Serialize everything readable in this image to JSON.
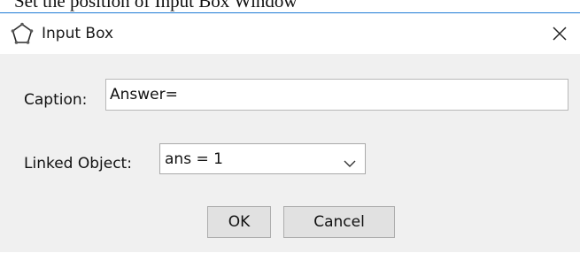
{
  "background_text": "Set the position of Input Box Window",
  "dialog": {
    "title": "Input Box",
    "app_icon": "pentagon-outline-icon",
    "close_icon": "close-x-icon"
  },
  "form": {
    "caption_label": "Caption:",
    "caption_value": "Answer=",
    "linked_object_label": "Linked Object:",
    "linked_object_value": "ans = 1",
    "dropdown_icon": "chevron-down-icon"
  },
  "buttons": {
    "ok": "OK",
    "cancel": "Cancel"
  },
  "colors": {
    "window_border_accent": "#1e7bd6",
    "dialog_background": "#f0f0f0",
    "button_face": "#e1e1e1"
  }
}
